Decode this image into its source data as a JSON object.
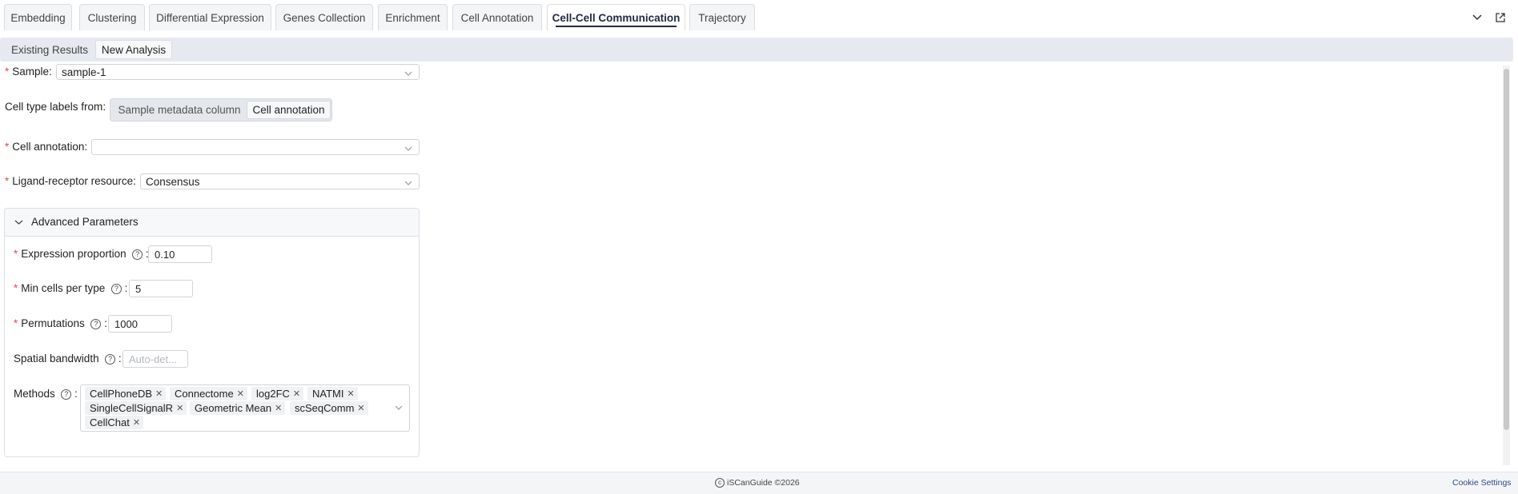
{
  "tabs": [
    {
      "label": "Embedding"
    },
    {
      "label": "Clustering"
    },
    {
      "label": "Differential Expression"
    },
    {
      "label": "Genes Collection"
    },
    {
      "label": "Enrichment"
    },
    {
      "label": "Cell Annotation"
    },
    {
      "label": "Cell-Cell Communication",
      "active": true
    },
    {
      "label": "Trajectory"
    }
  ],
  "subtabs": [
    {
      "label": "Existing Results"
    },
    {
      "label": "New Analysis",
      "active": true
    }
  ],
  "form": {
    "sample": {
      "label": "Sample",
      "value": "sample-1"
    },
    "cell_type_source": {
      "label": "Cell type labels from",
      "options": [
        "Sample metadata column",
        "Cell annotation"
      ],
      "selected": "Cell annotation"
    },
    "cell_annotation": {
      "label": "Cell annotation",
      "value": ""
    },
    "resource": {
      "label": "Ligand-receptor resource",
      "value": "Consensus"
    }
  },
  "advanced": {
    "title": "Advanced Parameters",
    "expression_proportion": {
      "label": "Expression proportion",
      "value": "0.10"
    },
    "min_cells": {
      "label": "Min cells per type",
      "value": "5"
    },
    "permutations": {
      "label": "Permutations",
      "value": "1000"
    },
    "spatial_bandwidth": {
      "label": "Spatial bandwidth",
      "placeholder": "Auto-det..."
    },
    "methods": {
      "label": "Methods",
      "selected": [
        "CellPhoneDB",
        "Connectome",
        "log2FC",
        "NATMI",
        "SingleCellSignalR",
        "Geometric Mean",
        "scSeqComm",
        "CellChat"
      ]
    }
  },
  "footer": {
    "copyright": "iSCanGuide ©2026",
    "cookie_link": "Cookie Settings"
  },
  "colors": {
    "accent": "#1f2a44",
    "required": "#e5484d",
    "link": "#2b4a8a"
  }
}
